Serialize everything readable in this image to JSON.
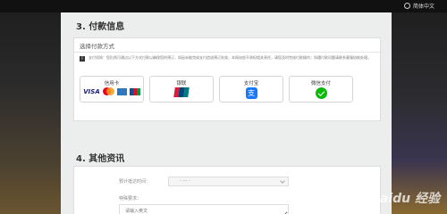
{
  "header": {
    "language": "简体中文"
  },
  "payment": {
    "title": "3. 付款信息",
    "choose_label": "选择付款方式",
    "notice": "支付须知：您仍然可通过以下方式付款以确保您的预订，如因未能完成支付造成预订失效，本网站恕不承担相关责任，请您及时完成付款操作；如遇付款问题请联系客服协助处理。",
    "methods": [
      {
        "label": "信用卡",
        "logos": [
          "visa-icon",
          "mastercard-icon",
          "amex-icon",
          "jcb-icon"
        ]
      },
      {
        "label": "银联",
        "logos": [
          "unionpay-icon"
        ]
      },
      {
        "label": "支付宝",
        "logos": [
          "alipay-icon"
        ]
      },
      {
        "label": "微信支付",
        "logos": [
          "wechat-pay-icon"
        ]
      }
    ],
    "visa_text": "VISA",
    "alipay_glyph": "支"
  },
  "other": {
    "title": "4. 其他资讯",
    "time_label": "预计抵达时间：",
    "time_value": "- -:- -",
    "request_label": "特殊要求：",
    "request_placeholder": "请输入英文"
  },
  "watermark": "Baidu 经验",
  "colors": {
    "page_bg": "#eceded",
    "alipay": "#1677ff",
    "wechat": "#09bb07",
    "visa": "#1a1f71"
  }
}
